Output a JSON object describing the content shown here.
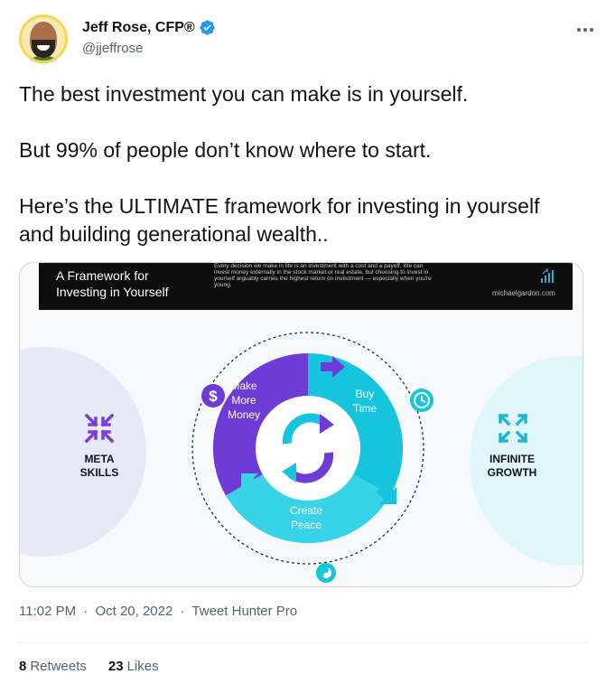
{
  "author": {
    "display_name": "Jeff Rose, CFP®",
    "handle": "@jjeffrose",
    "avatar_icon": "profile-photo",
    "verified_icon": "verified-badge-icon"
  },
  "tweet": {
    "paragraphs": [
      "The best investment you can make is in yourself.",
      "But 99% of people don’t know where to start.",
      "Here’s the ULTIMATE framework for investing in yourself and building generational wealth.."
    ]
  },
  "media": {
    "header_title_line1": "A Framework for",
    "header_title_line2": "Investing in Yourself",
    "header_description": "Every decision we make in life is an investment with a cost and a payoff. We can invest money externally in the stock market or real estate, but choosing to invest in yourself arguably carries the highest return on investment — especially when you're young.",
    "site": "michaelgardon.com",
    "left_label_line1": "META",
    "left_label_line2": "SKILLS",
    "right_label_line1": "INFINITE",
    "right_label_line2": "GROWTH",
    "segment_make_money_1": "Make",
    "segment_make_money_2": "More",
    "segment_make_money_3": "Money",
    "segment_buy_time_1": "Buy",
    "segment_buy_time_2": "Time",
    "segment_peace_1": "Create",
    "segment_peace_2": "Peace",
    "colors": {
      "purple": "#6f3bd6",
      "cyan": "#16c5dd",
      "light_cyan": "#38d3e6"
    }
  },
  "meta": {
    "time": "11:02 PM",
    "separator": "·",
    "date": "Oct 20, 2022",
    "source": "Tweet Hunter Pro"
  },
  "stats": {
    "retweets_count": "8",
    "retweets_label": "Retweets",
    "likes_count": "23",
    "likes_label": "Likes"
  },
  "colors": {
    "text": "#0f1419",
    "secondary": "#536471",
    "verified": "#1d9bf0"
  }
}
